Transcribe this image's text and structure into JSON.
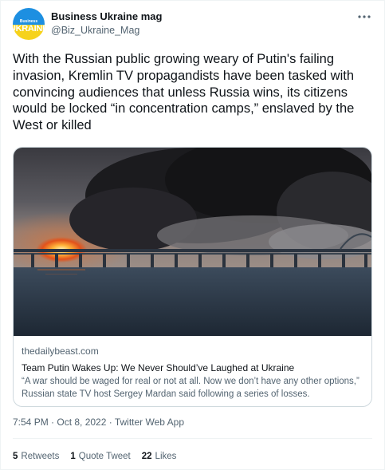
{
  "author": {
    "name": "Business Ukraine mag",
    "handle": "@Biz_Ukraine_Mag",
    "avatar_small": "Business",
    "avatar_big": "UKRAINE"
  },
  "more_icon": "more-horizontal-icon",
  "tweet": {
    "text": "With the Russian public growing weary of Putin's failing invasion, Kremlin TV propagandists have been tasked with convincing audiences that unless Russia wins, its citizens would be locked “in concentration camps,” enslaved by the West or killed"
  },
  "card": {
    "domain": "thedailybeast.com",
    "title": "Team Putin Wakes Up: We Never Should’ve Laughed at Ukraine",
    "description": "“A war should be waged for real or not at all. Now we don’t have any other options,” Russian state TV host Sergey Mardan said following a series of losses."
  },
  "timestamp": "7:54 PM · Oct 8, 2022 · Twitter Web App",
  "stats": {
    "retweets_count": "5",
    "retweets_label": "Retweets",
    "quotes_count": "1",
    "quotes_label": "Quote Tweet",
    "likes_count": "22",
    "likes_label": "Likes"
  },
  "colors": {
    "text": "#0f1419",
    "secondary": "#536471",
    "border": "#cfd9de",
    "avatar_blue": "#1d8fe1",
    "avatar_yellow": "#f6d21c"
  }
}
